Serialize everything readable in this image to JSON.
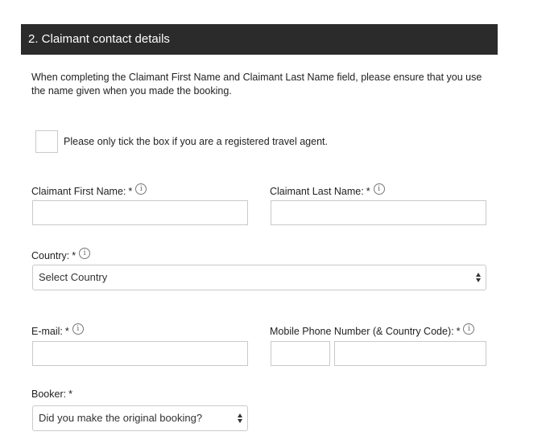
{
  "section": {
    "title": "2. Claimant contact details"
  },
  "intro": "When completing the Claimant First Name and Claimant Last Name field, please ensure that you use the name given when you made the booking.",
  "travel_agent": {
    "label": "Please only tick the box if you are a registered travel agent.",
    "checked": false
  },
  "fields": {
    "first_name": {
      "label": "Claimant First Name:",
      "required": "*",
      "value": ""
    },
    "last_name": {
      "label": "Claimant Last Name:",
      "required": "*",
      "value": ""
    },
    "country": {
      "label": "Country:",
      "required": "*",
      "selected": "Select Country"
    },
    "email": {
      "label": "E-mail:",
      "required": "*",
      "value": ""
    },
    "mobile": {
      "label": "Mobile Phone Number (& Country Code):",
      "required": "*",
      "code_value": "",
      "number_value": ""
    },
    "booker": {
      "label": "Booker:",
      "required": "*",
      "selected": "Did you make the original booking?"
    }
  },
  "icons": {
    "info": "info-icon",
    "select_arrows": "select-arrows-icon"
  }
}
